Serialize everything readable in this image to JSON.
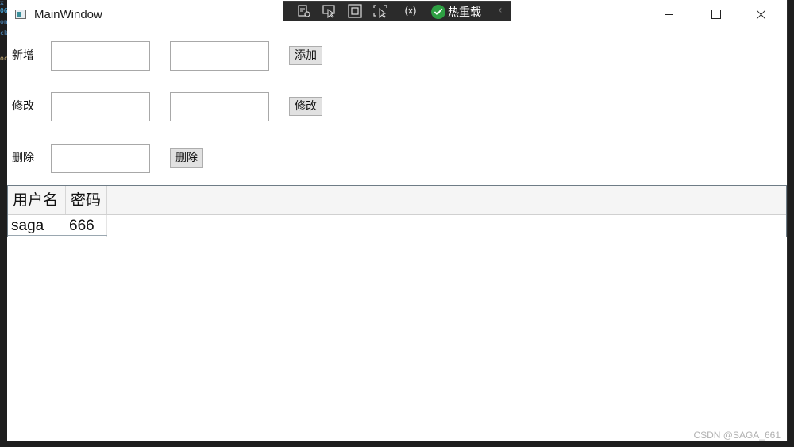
{
  "window": {
    "title": "MainWindow"
  },
  "devbar": {
    "icons": [
      "visual-tree-icon",
      "select-element-icon",
      "display-layout-adorners-icon",
      "track-focus-icon",
      "binding-failures-icon"
    ],
    "hot_reload_label": "热重载"
  },
  "form": {
    "add": {
      "label": "新增",
      "field1": "",
      "field2": "",
      "button": "添加"
    },
    "edit": {
      "label": "修改",
      "field1": "",
      "field2": "",
      "button": "修改"
    },
    "delete": {
      "label": "删除",
      "field1": "",
      "button": "删除"
    }
  },
  "grid": {
    "columns": [
      "用户名",
      "密码"
    ],
    "rows": [
      [
        "saga",
        "666"
      ]
    ]
  },
  "watermark": "CSDN @SAGA_661",
  "colors": {
    "hot_reload_green": "#2ea043",
    "devbar_bg": "#2b2b2b",
    "button_bg": "#e1e1e1"
  }
}
